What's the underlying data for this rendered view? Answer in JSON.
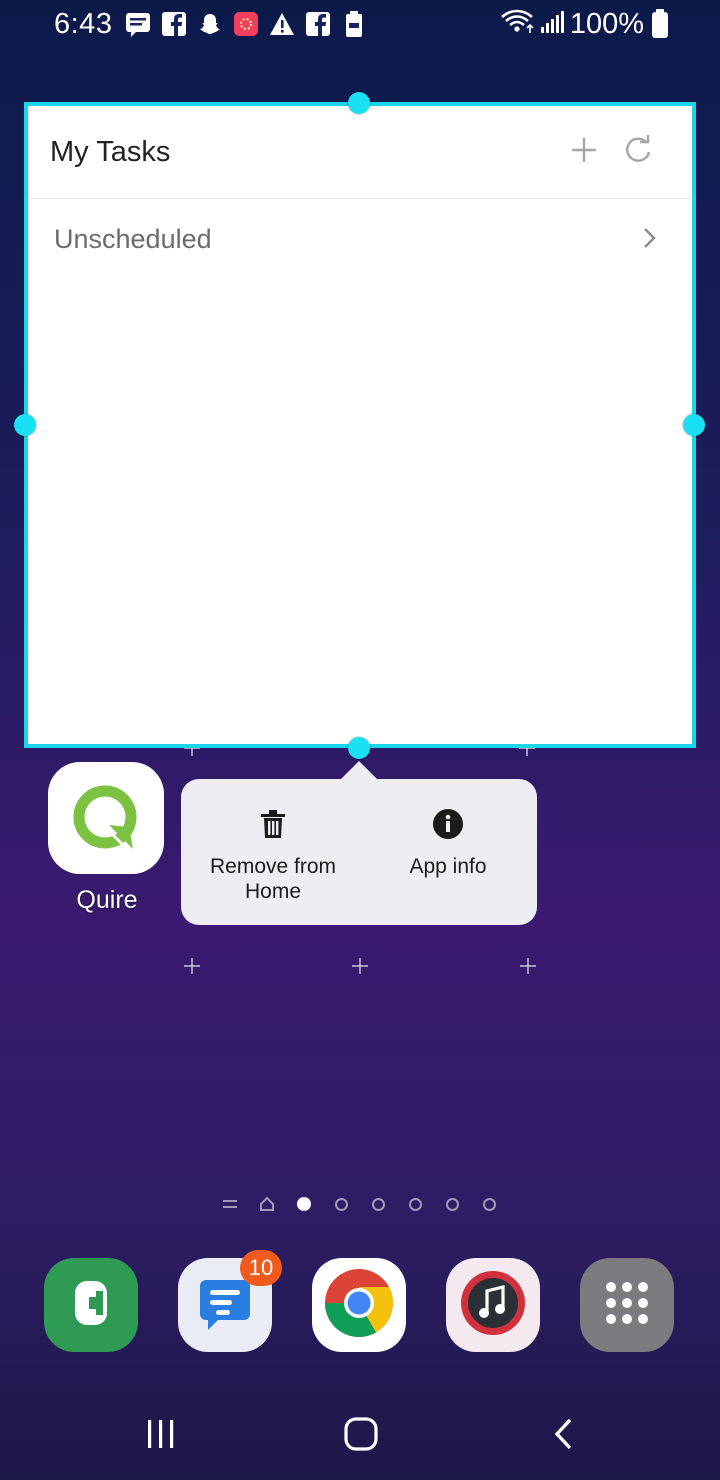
{
  "status_bar": {
    "time": "6:43",
    "notification_icons": [
      "message-icon",
      "facebook-icon",
      "snapchat-icon",
      "app-icon",
      "warning-icon",
      "facebook-icon",
      "battery-saver-icon"
    ],
    "battery": "100%"
  },
  "widget": {
    "title": "My Tasks",
    "add_icon": "plus-icon",
    "refresh_icon": "refresh-icon",
    "rows": [
      {
        "label": "Unscheduled"
      }
    ],
    "frame_color": "#19d6e8"
  },
  "app": {
    "name": "Quire",
    "icon": "quire-logo-icon",
    "brand_color": "#7cc142"
  },
  "popup_menu": {
    "items": [
      {
        "label": "Remove from Home",
        "icon": "trash-icon"
      },
      {
        "label": "App info",
        "icon": "info-icon"
      }
    ]
  },
  "page_indicator": {
    "pages": [
      "menu",
      "home",
      "active",
      "dot",
      "dot",
      "dot",
      "dot",
      "dot"
    ],
    "active_index": 2
  },
  "dock": {
    "apps": [
      {
        "name": "Phone",
        "icon": "phone-icon",
        "color": "#2e9a54"
      },
      {
        "name": "Messages",
        "icon": "messages-icon",
        "color": "#2a7de1",
        "badge": "10"
      },
      {
        "name": "Chrome",
        "icon": "chrome-icon"
      },
      {
        "name": "Music",
        "icon": "music-icon",
        "color": "#d0313c"
      },
      {
        "name": "Apps",
        "icon": "apps-grid-icon",
        "color": "#7b7b80"
      }
    ]
  },
  "nav_bar": {
    "buttons": [
      "recents-icon",
      "home-icon",
      "back-icon"
    ]
  }
}
